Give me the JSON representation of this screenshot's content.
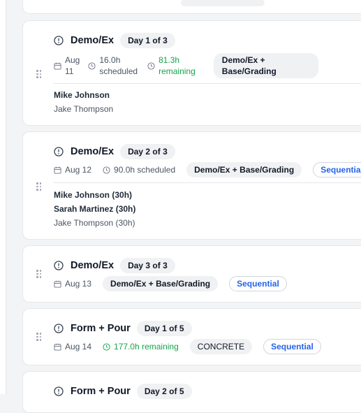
{
  "colors": {
    "accent": "#2563eb",
    "remaining": "#16a34a",
    "badge_bg": "#f0f1f3"
  },
  "cards": [
    {
      "title": "Demo/Ex",
      "day": "Day 1 of 3",
      "date_line1": "Aug",
      "date_line2": "11",
      "sched_line1": "16.0h",
      "sched_line2": "scheduled",
      "remain_line1": "81.3h",
      "remain_line2": "remaining",
      "pill_line1": "Demo/Ex +",
      "pill_line2": "Base/Grading",
      "workers": [
        "Mike Johnson",
        "Jake Thompson"
      ]
    },
    {
      "title": "Demo/Ex",
      "day": "Day 2 of 3",
      "date": "Aug 12",
      "scheduled": "90.0h scheduled",
      "pill": "Demo/Ex + Base/Grading",
      "sequential": "Sequential",
      "workers": [
        "Mike Johnson (30h)",
        "Sarah Martinez (30h)",
        "Jake Thompson (30h)"
      ]
    },
    {
      "title": "Demo/Ex",
      "day": "Day 3 of 3",
      "date": "Aug 13",
      "pill": "Demo/Ex + Base/Grading",
      "sequential": "Sequential"
    },
    {
      "title": "Form + Pour",
      "day": "Day 1 of 5",
      "date": "Aug 14",
      "remaining": "177.0h remaining",
      "pill": "CONCRETE",
      "sequential": "Sequential"
    },
    {
      "title": "Form + Pour",
      "day": "Day 2 of 5"
    }
  ],
  "icons": [
    "drag-handle-icon",
    "alert-circle-icon",
    "calendar-icon",
    "clock-icon"
  ]
}
